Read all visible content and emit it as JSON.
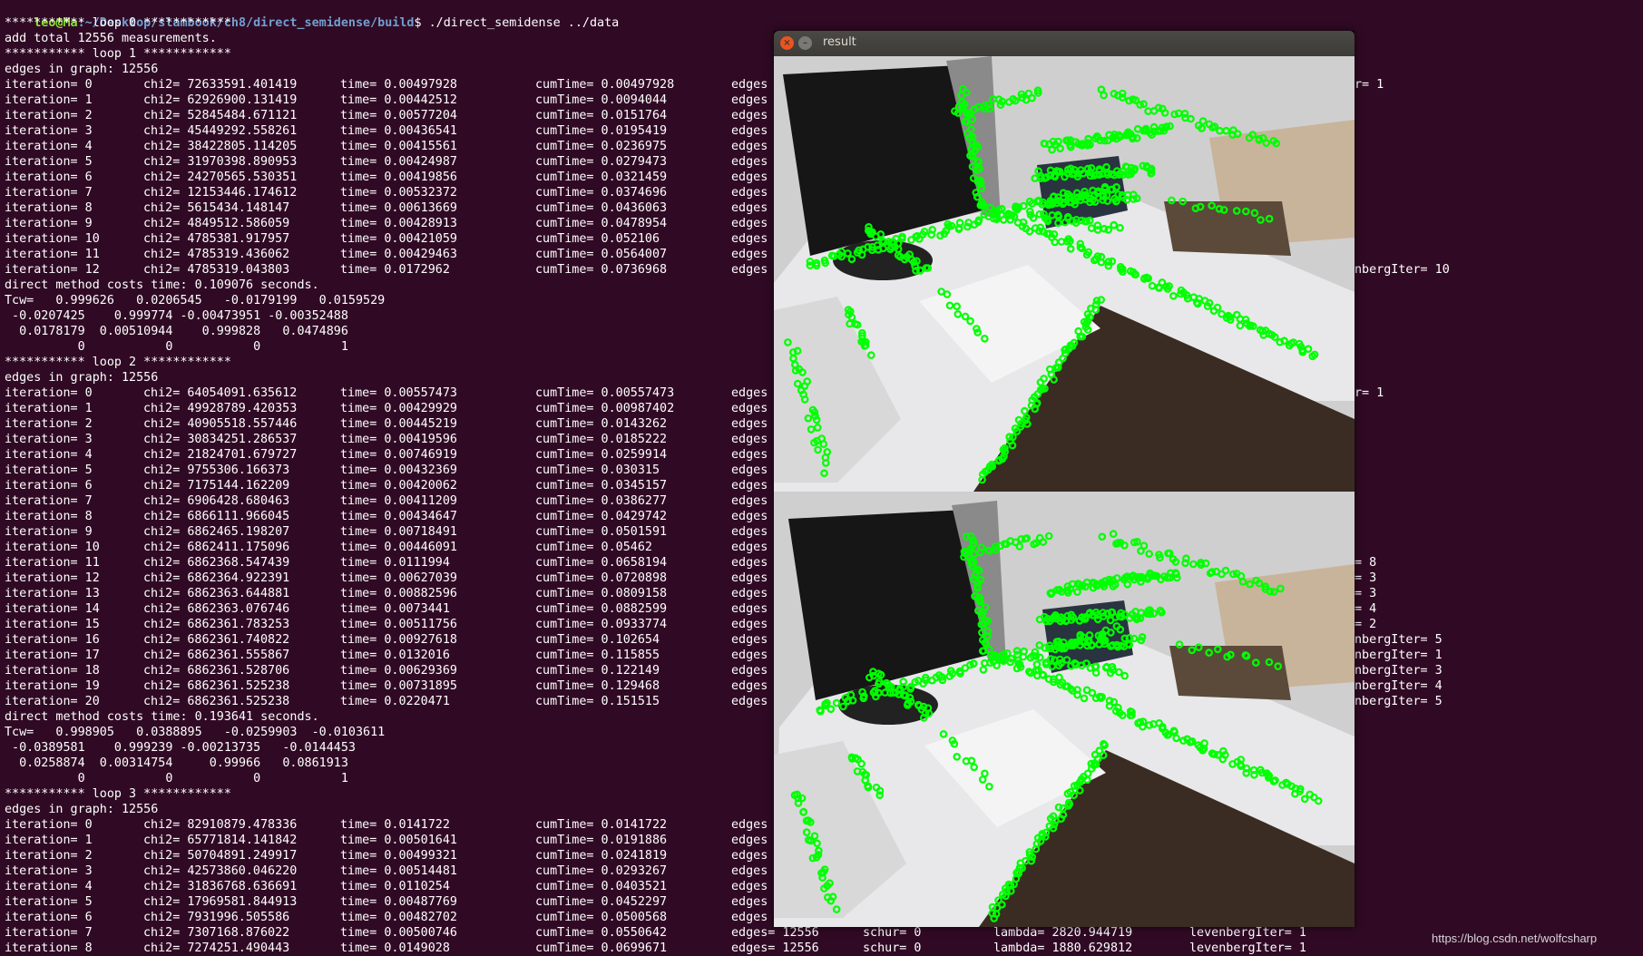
{
  "prompt": {
    "user": "leo@Ma",
    "path": ":~/Desktop/slambook/ch8/direct_semidense/build",
    "command": "$ ./direct_semidense ../data"
  },
  "terminal_lines": [
    {
      "text": "*********** loop 0 ************"
    },
    {
      "text": "add total 12556 measurements."
    },
    {
      "text": "*********** loop 1 ************"
    },
    {
      "text": "edges in graph: 12556"
    },
    {
      "it": "iteration= 0",
      "chi2": "chi2= 72633591.401419",
      "time": "time= 0.00497928",
      "cum": "cumTime= 0.00497928",
      "edges": "edges",
      "tail": "r= 1"
    },
    {
      "it": "iteration= 1",
      "chi2": "chi2= 62926900.131419",
      "time": "time= 0.00442512",
      "cum": "cumTime= 0.0094044",
      "edges": "edges"
    },
    {
      "it": "iteration= 2",
      "chi2": "chi2= 52845484.671121",
      "time": "time= 0.00577204",
      "cum": "cumTime= 0.0151764",
      "edges": "edges"
    },
    {
      "it": "iteration= 3",
      "chi2": "chi2= 45449292.558261",
      "time": "time= 0.00436541",
      "cum": "cumTime= 0.0195419",
      "edges": "edges"
    },
    {
      "it": "iteration= 4",
      "chi2": "chi2= 38422805.114205",
      "time": "time= 0.00415561",
      "cum": "cumTime= 0.0236975",
      "edges": "edges"
    },
    {
      "it": "iteration= 5",
      "chi2": "chi2= 31970398.890953",
      "time": "time= 0.00424987",
      "cum": "cumTime= 0.0279473",
      "edges": "edges"
    },
    {
      "it": "iteration= 6",
      "chi2": "chi2= 24270565.530351",
      "time": "time= 0.00419856",
      "cum": "cumTime= 0.0321459",
      "edges": "edges"
    },
    {
      "it": "iteration= 7",
      "chi2": "chi2= 12153446.174612",
      "time": "time= 0.00532372",
      "cum": "cumTime= 0.0374696",
      "edges": "edges"
    },
    {
      "it": "iteration= 8",
      "chi2": "chi2= 5615434.148147",
      "time": "time= 0.00613669",
      "cum": "cumTime= 0.0436063",
      "edges": "edges"
    },
    {
      "it": "iteration= 9",
      "chi2": "chi2= 4849512.586059",
      "time": "time= 0.00428913",
      "cum": "cumTime= 0.0478954",
      "edges": "edges"
    },
    {
      "it": "iteration= 10",
      "chi2": "chi2= 4785381.917957",
      "time": "time= 0.00421059",
      "cum": "cumTime= 0.052106",
      "edges": "edges"
    },
    {
      "it": "iteration= 11",
      "chi2": "chi2= 4785319.436062",
      "time": "time= 0.00429463",
      "cum": "cumTime= 0.0564007",
      "edges": "edges"
    },
    {
      "it": "iteration= 12",
      "chi2": "chi2= 4785319.043803",
      "time": "time= 0.0172962",
      "cum": "cumTime= 0.0736968",
      "edges": "edges",
      "tail": "nbergIter= 10"
    },
    {
      "text": "direct method costs time: 0.109076 seconds."
    },
    {
      "text": "Tcw=   0.999626   0.0206545   -0.0179199   0.0159529"
    },
    {
      "text": " -0.0207425    0.999774 -0.00473951 -0.00352488"
    },
    {
      "text": "  0.0178179  0.00510944    0.999828   0.0474896"
    },
    {
      "text": "          0           0           0           1"
    },
    {
      "text": "*********** loop 2 ************"
    },
    {
      "text": "edges in graph: 12556"
    },
    {
      "it": "iteration= 0",
      "chi2": "chi2= 64054091.635612",
      "time": "time= 0.00557473",
      "cum": "cumTime= 0.00557473",
      "edges": "edges",
      "tail": "r= 1"
    },
    {
      "it": "iteration= 1",
      "chi2": "chi2= 49928789.420353",
      "time": "time= 0.00429929",
      "cum": "cumTime= 0.00987402",
      "edges": "edges"
    },
    {
      "it": "iteration= 2",
      "chi2": "chi2= 40905518.557446",
      "time": "time= 0.00445219",
      "cum": "cumTime= 0.0143262",
      "edges": "edges"
    },
    {
      "it": "iteration= 3",
      "chi2": "chi2= 30834251.286537",
      "time": "time= 0.00419596",
      "cum": "cumTime= 0.0185222",
      "edges": "edges"
    },
    {
      "it": "iteration= 4",
      "chi2": "chi2= 21824701.679727",
      "time": "time= 0.00746919",
      "cum": "cumTime= 0.0259914",
      "edges": "edges"
    },
    {
      "it": "iteration= 5",
      "chi2": "chi2= 9755306.166373",
      "time": "time= 0.00432369",
      "cum": "cumTime= 0.030315",
      "edges": "edges"
    },
    {
      "it": "iteration= 6",
      "chi2": "chi2= 7175144.162209",
      "time": "time= 0.00420062",
      "cum": "cumTime= 0.0345157",
      "edges": "edges"
    },
    {
      "it": "iteration= 7",
      "chi2": "chi2= 6906428.680463",
      "time": "time= 0.00411209",
      "cum": "cumTime= 0.0386277",
      "edges": "edges"
    },
    {
      "it": "iteration= 8",
      "chi2": "chi2= 6866111.966045",
      "time": "time= 0.00434647",
      "cum": "cumTime= 0.0429742",
      "edges": "edges"
    },
    {
      "it": "iteration= 9",
      "chi2": "chi2= 6862465.198207",
      "time": "time= 0.00718491",
      "cum": "cumTime= 0.0501591",
      "edges": "edges"
    },
    {
      "it": "iteration= 10",
      "chi2": "chi2= 6862411.175096",
      "time": "time= 0.00446091",
      "cum": "cumTime= 0.05462",
      "edges": "edges"
    },
    {
      "it": "iteration= 11",
      "chi2": "chi2= 6862368.547439",
      "time": "time= 0.0111994",
      "cum": "cumTime= 0.0658194",
      "edges": "edges",
      "tail": "= 8"
    },
    {
      "it": "iteration= 12",
      "chi2": "chi2= 6862364.922391",
      "time": "time= 0.00627039",
      "cum": "cumTime= 0.0720898",
      "edges": "edges",
      "tail": "= 3"
    },
    {
      "it": "iteration= 13",
      "chi2": "chi2= 6862363.644881",
      "time": "time= 0.00882596",
      "cum": "cumTime= 0.0809158",
      "edges": "edges",
      "tail": "= 3"
    },
    {
      "it": "iteration= 14",
      "chi2": "chi2= 6862363.076746",
      "time": "time= 0.0073441",
      "cum": "cumTime= 0.0882599",
      "edges": "edges",
      "tail": "= 4"
    },
    {
      "it": "iteration= 15",
      "chi2": "chi2= 6862361.783253",
      "time": "time= 0.00511756",
      "cum": "cumTime= 0.0933774",
      "edges": "edges",
      "tail": "= 2"
    },
    {
      "it": "iteration= 16",
      "chi2": "chi2= 6862361.740822",
      "time": "time= 0.00927618",
      "cum": "cumTime= 0.102654",
      "edges": "edges",
      "tail": "nbergIter= 5"
    },
    {
      "it": "iteration= 17",
      "chi2": "chi2= 6862361.555867",
      "time": "time= 0.0132016",
      "cum": "cumTime= 0.115855",
      "edges": "edges",
      "tail": "nbergIter= 1"
    },
    {
      "it": "iteration= 18",
      "chi2": "chi2= 6862361.528706",
      "time": "time= 0.00629369",
      "cum": "cumTime= 0.122149",
      "edges": "edges",
      "tail": "nbergIter= 3"
    },
    {
      "it": "iteration= 19",
      "chi2": "chi2= 6862361.525238",
      "time": "time= 0.00731895",
      "cum": "cumTime= 0.129468",
      "edges": "edges",
      "tail": "nbergIter= 4"
    },
    {
      "it": "iteration= 20",
      "chi2": "chi2= 6862361.525238",
      "time": "time= 0.0220471",
      "cum": "cumTime= 0.151515",
      "edges": "edges",
      "tail": "nbergIter= 5"
    },
    {
      "text": "direct method costs time: 0.193641 seconds."
    },
    {
      "text": "Tcw=   0.998905   0.0388895   -0.0259903  -0.0103611"
    },
    {
      "text": " -0.0389581    0.999239 -0.00213735   -0.0144453"
    },
    {
      "text": "  0.0258874  0.00314754     0.99966   0.0861913"
    },
    {
      "text": "          0           0           0           1"
    },
    {
      "text": "*********** loop 3 ************"
    },
    {
      "text": "edges in graph: 12556"
    },
    {
      "it": "iteration= 0",
      "chi2": "chi2= 82910879.478336",
      "time": "time= 0.0141722",
      "cum": "cumTime= 0.0141722",
      "edges": "edges"
    },
    {
      "it": "iteration= 1",
      "chi2": "chi2= 65771814.141842",
      "time": "time= 0.00501641",
      "cum": "cumTime= 0.0191886",
      "edges": "edges"
    },
    {
      "it": "iteration= 2",
      "chi2": "chi2= 50704891.249917",
      "time": "time= 0.00499321",
      "cum": "cumTime= 0.0241819",
      "edges": "edges"
    },
    {
      "it": "iteration= 3",
      "chi2": "chi2= 42573860.046220",
      "time": "time= 0.00514481",
      "cum": "cumTime= 0.0293267",
      "edges": "edges"
    },
    {
      "it": "iteration= 4",
      "chi2": "chi2= 31836768.636691",
      "time": "time= 0.0110254",
      "cum": "cumTime= 0.0403521",
      "edges": "edges"
    },
    {
      "it": "iteration= 5",
      "chi2": "chi2= 17969581.844913",
      "time": "time= 0.00487769",
      "cum": "cumTime= 0.0452297",
      "edges": "edges"
    },
    {
      "it": "iteration= 6",
      "chi2": "chi2= 7931996.505586",
      "time": "time= 0.00482702",
      "cum": "cumTime= 0.0500568",
      "edges": "edges"
    },
    {
      "it": "iteration= 7",
      "chi2": "chi2= 7307168.876022",
      "time": "time= 0.00500746",
      "cum": "cumTime= 0.0550642",
      "edges": "edges= 12556",
      "schur": "schur= 0",
      "lambda": "lambda= 2820.944719",
      "lev": "levenbergIter= 1"
    },
    {
      "it": "iteration= 8",
      "chi2": "chi2= 7274251.490443",
      "time": "time= 0.0149028",
      "cum": "cumTime= 0.0699671",
      "edges": "edges= 12556",
      "schur": "schur= 0",
      "lambda": "lambda= 1880.629812",
      "lev": "levenbergIter= 1"
    }
  ],
  "result_window": {
    "title": "result",
    "close_glyph": "×",
    "min_glyph": "–"
  },
  "watermark": "https://blog.csdn.net/wolfcsharp",
  "colors": {
    "terminal_bg": "#300a24",
    "prompt_user": "#8ae234",
    "prompt_path": "#729fcf",
    "feature_points": "#00ff00"
  },
  "icons": [
    "close-icon",
    "minimize-icon"
  ]
}
